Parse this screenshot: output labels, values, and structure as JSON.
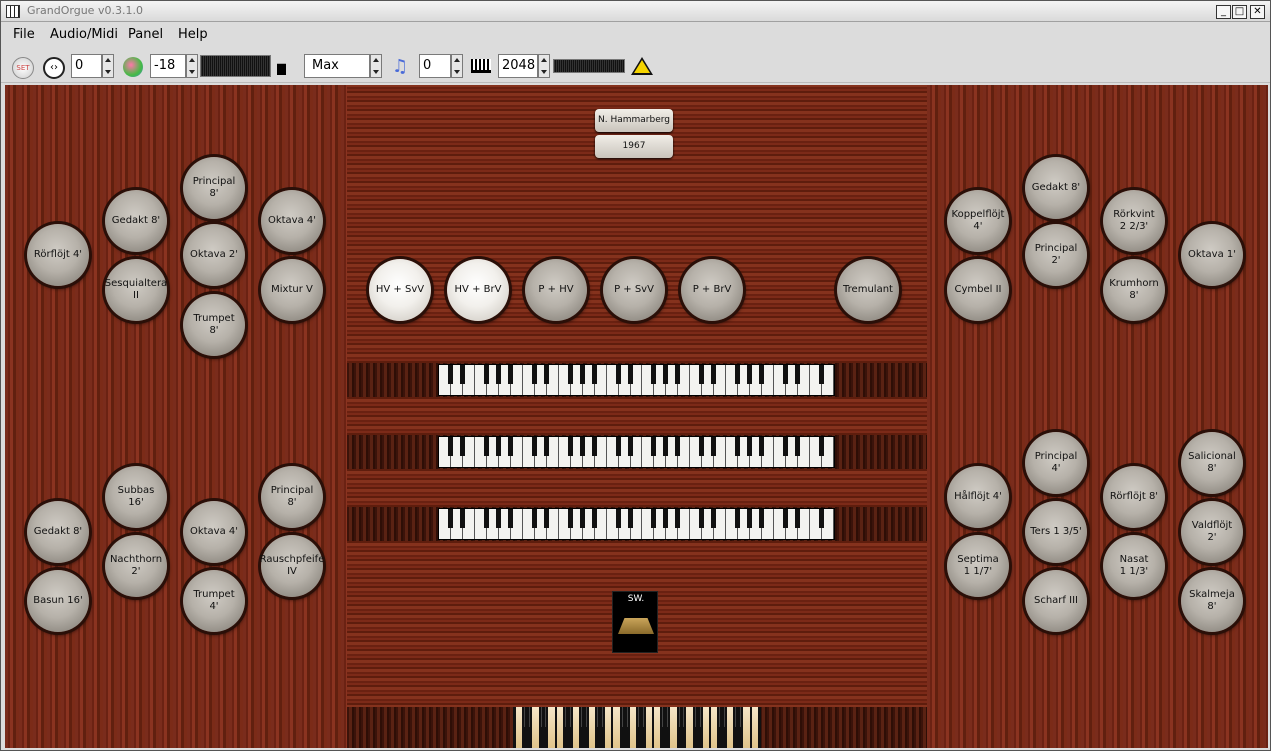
{
  "window": {
    "title": "GrandOrgue v0.3.1.0"
  },
  "menu": [
    "File",
    "Audio/Midi",
    "Panel",
    "Help"
  ],
  "toolbar": {
    "set_label": "SET",
    "memory_value": "0",
    "volume_value": "-18",
    "polyphony_mode": "Max",
    "transpose_value": "0",
    "polyphony_value": "2048"
  },
  "nameplates": {
    "builder": "N. Hammarberg",
    "year": "1967"
  },
  "couplers": [
    {
      "label": "HV + SvV",
      "on": true
    },
    {
      "label": "HV + BrV",
      "on": true
    },
    {
      "label": "P + HV",
      "on": false
    },
    {
      "label": "P + SvV",
      "on": false
    },
    {
      "label": "P + BrV",
      "on": false
    },
    {
      "label": "Tremulant",
      "on": false
    }
  ],
  "left_upper_stops": [
    "Rörflöjt 4'",
    "Gedakt 8'",
    "Sesquialtera\nII",
    "Principal\n8'",
    "Oktava 2'",
    "Trumpet\n8'",
    "Oktava 4'",
    "Mixtur V"
  ],
  "left_lower_stops": [
    "Gedakt 8'",
    "Basun 16'",
    "Subbas\n16'",
    "Nachthorn\n2'",
    "Oktava 4'",
    "Trumpet\n4'",
    "Principal\n8'",
    "Rauschpfeife\nIV"
  ],
  "right_upper_stops": [
    "Koppelflöjt\n4'",
    "Cymbel II",
    "Gedakt 8'",
    "Principal\n2'",
    "Rörkvint\n2 2/3'",
    "Krumhorn\n8'",
    "Oktava 1'"
  ],
  "right_lower_stops": [
    "Hålflöjt 4'",
    "Septima\n1 1/7'",
    "Principal\n4'",
    "Ters 1 3/5'",
    "Scharf III",
    "Rörflöjt 8'",
    "Nasat\n1 1/3'",
    "Salicional\n8'",
    "Valdflöjt\n2'",
    "Skalmeja\n8'"
  ],
  "swell": {
    "label": "SW."
  },
  "icons": [
    "piano-icon",
    "set-icon",
    "memory-icon",
    "volume-icon",
    "polyphony-icon",
    "transpose-icon",
    "keyboard-icon",
    "warning-icon"
  ]
}
